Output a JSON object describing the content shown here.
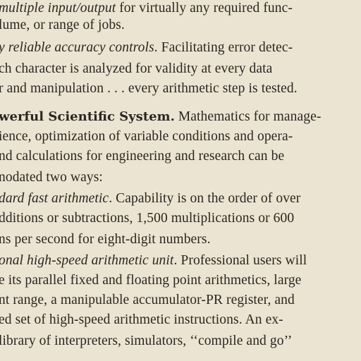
{
  "lines": [
    {
      "pre": "",
      "italic": "multiple input/output",
      "rest": " for virtually any required func-"
    },
    {
      "pre": "",
      "italic": "",
      "rest": "lume, or range of jobs."
    },
    {
      "pre": "",
      "italic": "y reliable accuracy controls",
      "rest": ". Facilitating error detec-"
    },
    {
      "pre": "",
      "italic": "",
      "rest": "ch character is analyzed for validity at every data"
    },
    {
      "pre": "",
      "italic": "",
      "rest": "r and manipulation . . . every arithmetic step is tested."
    },
    {
      "bold": "werful Scientific System.",
      "rest": " Mathematics for manage-"
    },
    {
      "pre": "",
      "italic": "",
      "rest": "ience, optimization of variable conditions and opera-"
    },
    {
      "pre": "",
      "italic": "",
      "rest": "nd calculations for engineering and research can be"
    },
    {
      "pre": "",
      "italic": "",
      "rest": "nodated two ways:"
    },
    {
      "pre": "",
      "italic": "dard fast arithmetic",
      "rest": ". Capability is on the order of over"
    },
    {
      "pre": "",
      "italic": "",
      "rest": "dditions or subtractions, 1,500 multiplications or 600"
    },
    {
      "pre": "",
      "italic": "",
      "rest": "ns per second for eight-digit numbers."
    },
    {
      "pre": "",
      "italic": "onal high-speed arithmetic unit",
      "rest": ". Professional users will"
    },
    {
      "pre": "",
      "italic": "",
      "rest": "e its parallel fixed and floating point arithmetics, large"
    },
    {
      "pre": "",
      "italic": "",
      "rest": "nt range, a manipulable accumulator-PR register, and"
    },
    {
      "pre": "",
      "italic": "",
      "rest": "ed set of high-speed arithmetic instructions. An ex-"
    },
    {
      "pre": "",
      "italic": "",
      "rest": " library of interpreters, simulators, ‘‘compile and go’’"
    }
  ]
}
